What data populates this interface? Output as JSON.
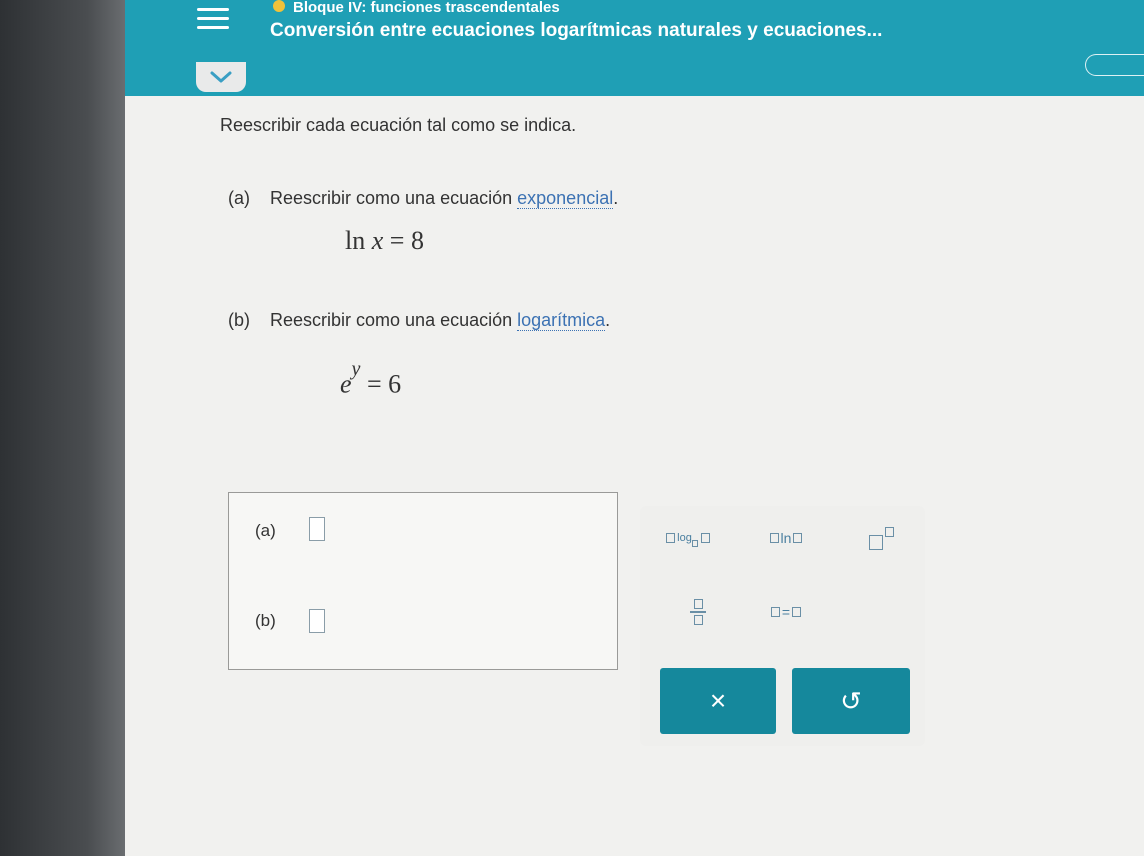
{
  "header": {
    "subtitle": "Bloque IV: funciones trascendentales",
    "title": "Conversión entre ecuaciones logarítmicas naturales y ecuaciones..."
  },
  "problem": {
    "instruction": "Reescribir cada ecuación tal como se indica.",
    "part_a": {
      "label": "(a)",
      "text_before": "Reescribir como una ecuación ",
      "link": "exponencial",
      "text_after": ".",
      "equation": {
        "func": "ln",
        "var": "x",
        "eq": "=",
        "value": "8"
      }
    },
    "part_b": {
      "label": "(b)",
      "text_before": "Reescribir como una ecuación ",
      "link": "logarítmica",
      "text_after": ".",
      "equation": {
        "base": "e",
        "exp": "y",
        "eq": "=",
        "value": "6"
      }
    }
  },
  "answers": {
    "a_label": "(a)",
    "b_label": "(b)"
  },
  "keypad": {
    "log_text": "log",
    "ln_text": "ln",
    "equals_text": "=",
    "clear_symbol": "×",
    "undo_symbol": "↺",
    "accent": "#15889c"
  }
}
